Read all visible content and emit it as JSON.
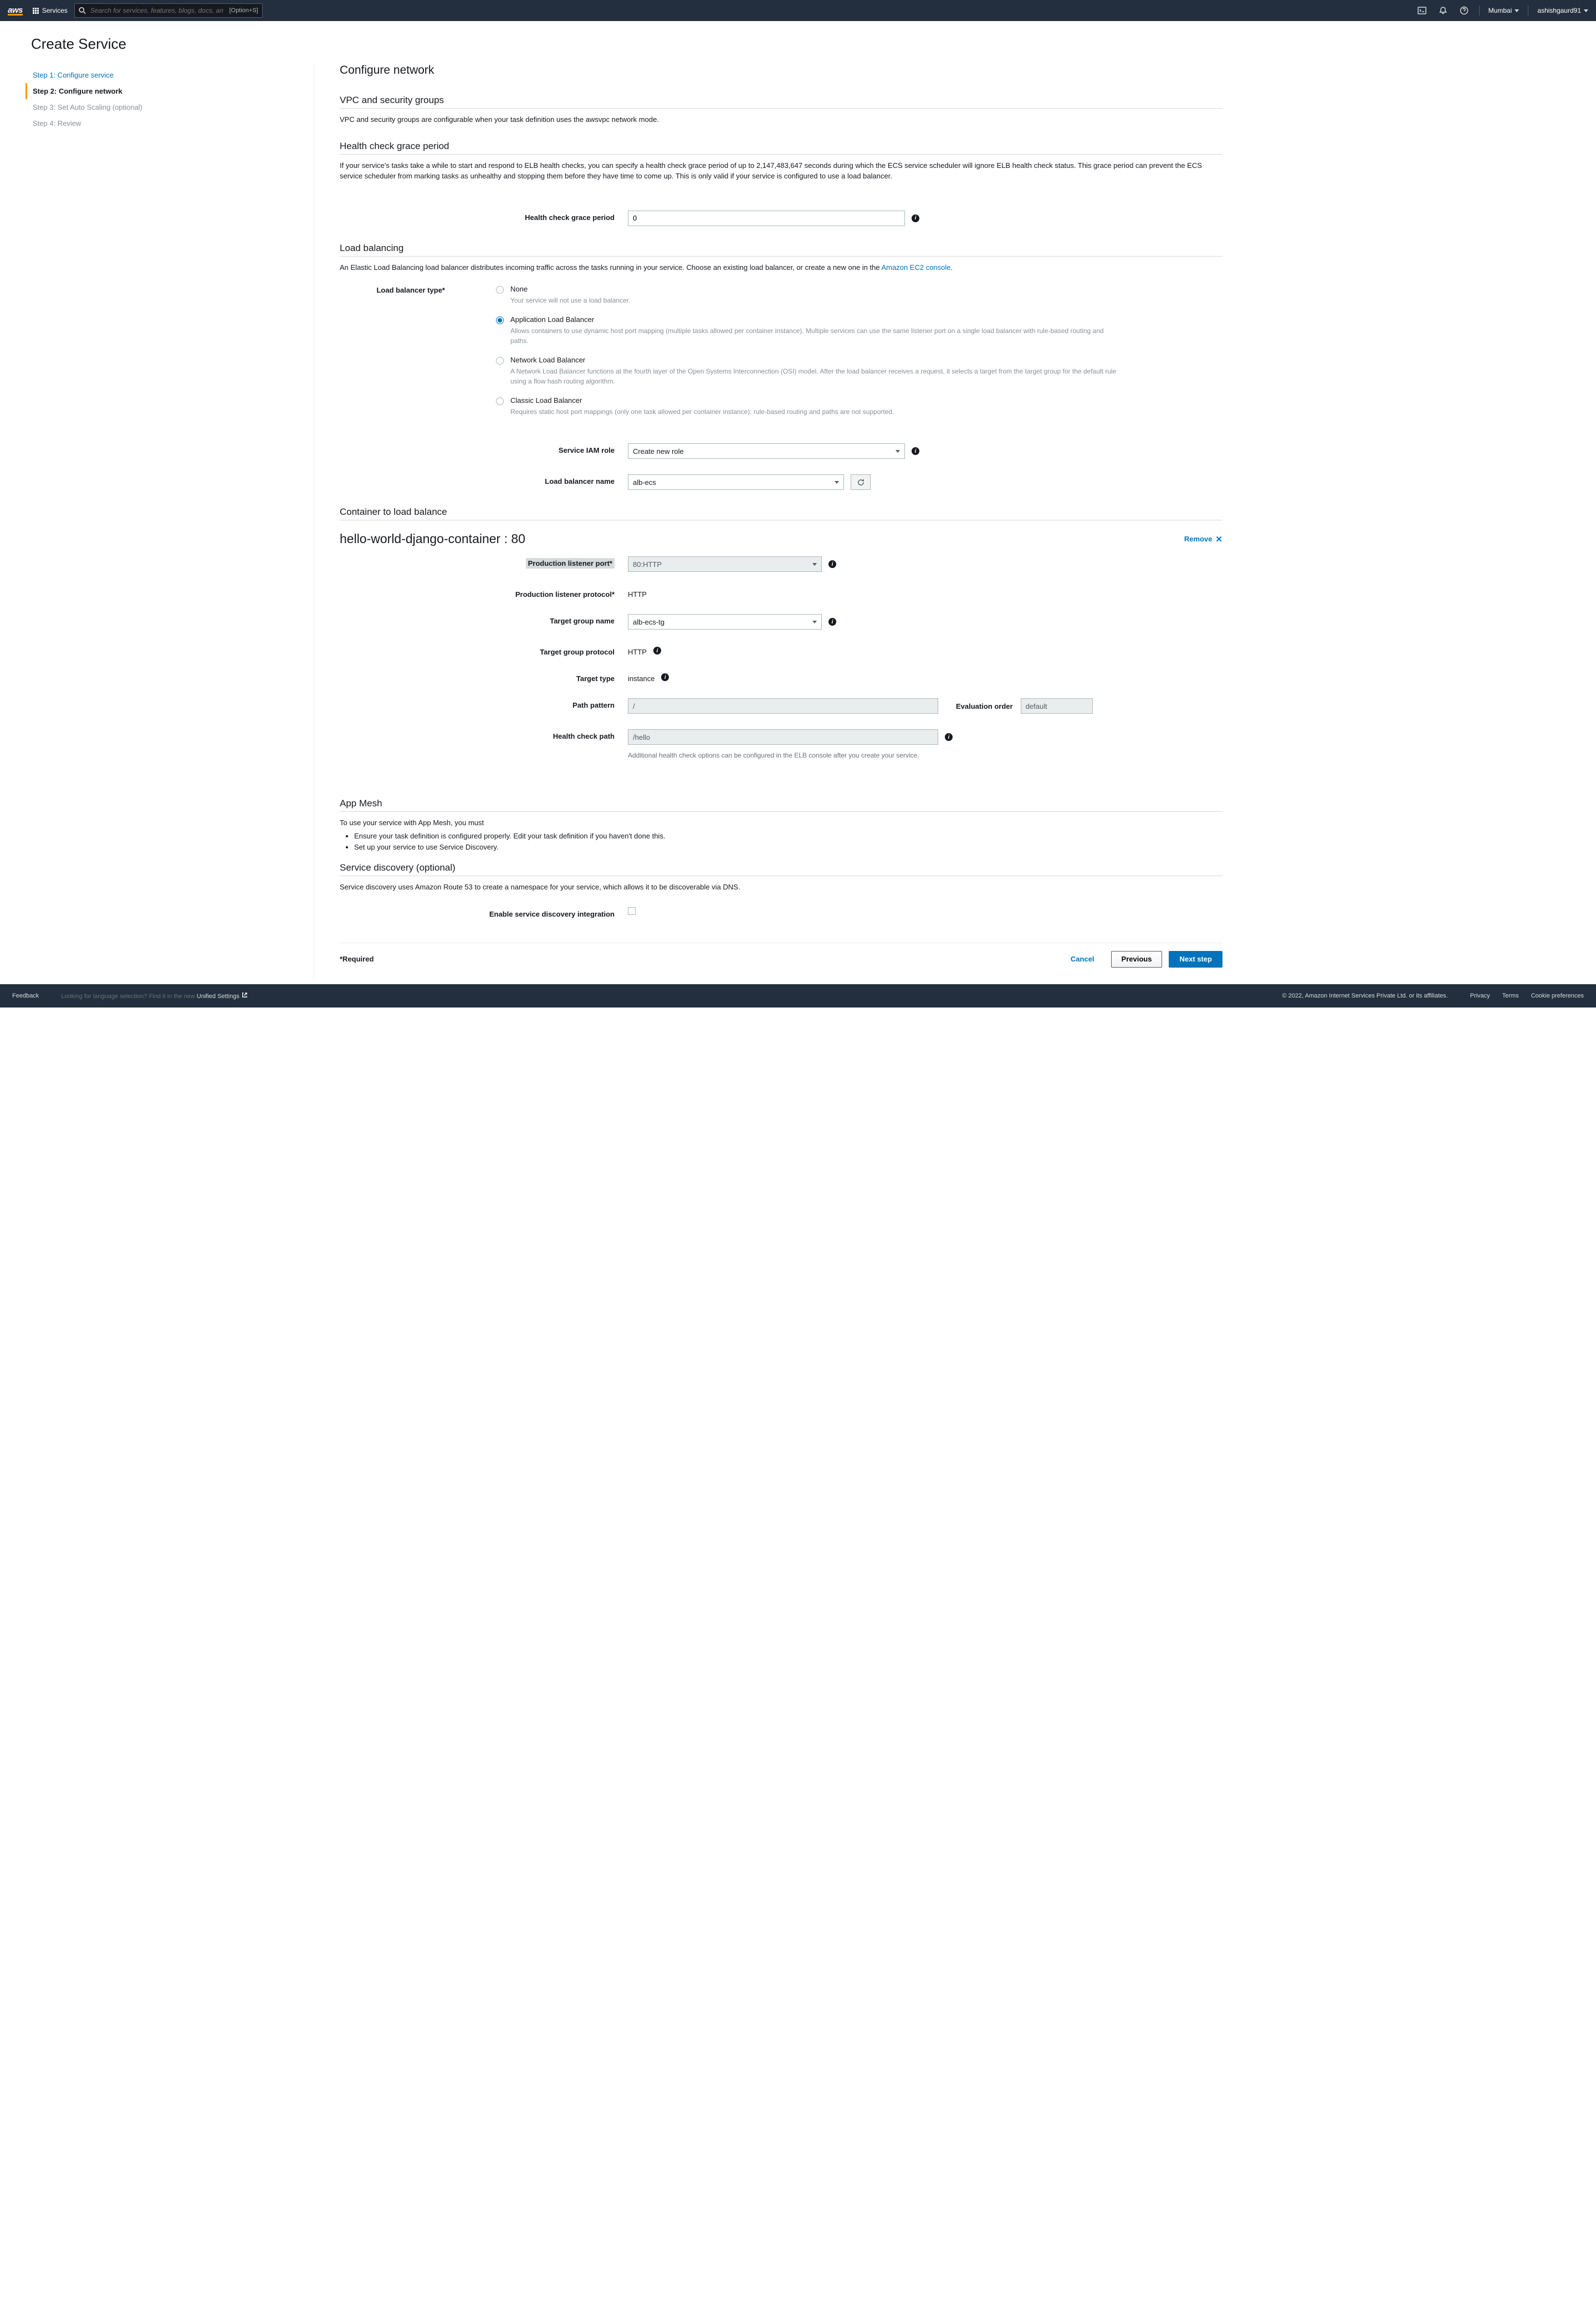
{
  "nav": {
    "logo": "aws",
    "services": "Services",
    "search_placeholder": "Search for services, features, blogs, docs, and more",
    "search_shortcut": "[Option+S]",
    "region": "Mumbai",
    "user": "ashishgaurd91"
  },
  "page": {
    "title": "Create Service"
  },
  "steps": [
    {
      "label": "Step 1: Configure service",
      "state": "link"
    },
    {
      "label": "Step 2: Configure network",
      "state": "active"
    },
    {
      "label": "Step 3: Set Auto Scaling (optional)",
      "state": "future"
    },
    {
      "label": "Step 4: Review",
      "state": "future"
    }
  ],
  "main_title": "Configure network",
  "vpc": {
    "title": "VPC and security groups",
    "desc": "VPC and security groups are configurable when your task definition uses the awsvpc network mode."
  },
  "hc": {
    "title": "Health check grace period",
    "desc": "If your service's tasks take a while to start and respond to ELB health checks, you can specify a health check grace period of up to 2,147,483,647 seconds during which the ECS service scheduler will ignore ELB health check status. This grace period can prevent the ECS service scheduler from marking tasks as unhealthy and stopping them before they have time to come up. This is only valid if your service is configured to use a load balancer.",
    "label": "Health check grace period",
    "value": "0"
  },
  "lb": {
    "title": "Load balancing",
    "desc_pre": "An Elastic Load Balancing load balancer distributes incoming traffic across the tasks running in your service. Choose an existing load balancer, or create a new one in the ",
    "desc_link": "Amazon EC2 console",
    "desc_post": ".",
    "type_label": "Load balancer type*",
    "options": [
      {
        "title": "None",
        "desc": "Your service will not use a load balancer.",
        "selected": false
      },
      {
        "title": "Application Load Balancer",
        "desc": "Allows containers to use dynamic host port mapping (multiple tasks allowed per container instance). Multiple services can use the same listener port on a single load balancer with rule-based routing and paths.",
        "selected": true
      },
      {
        "title": "Network Load Balancer",
        "desc": "A Network Load Balancer functions at the fourth layer of the Open Systems Interconnection (OSI) model. After the load balancer receives a request, it selects a target from the target group for the default rule using a flow hash routing algorithm.",
        "selected": false
      },
      {
        "title": "Classic Load Balancer",
        "desc": "Requires static host port mappings (only one task allowed per container instance); rule-based routing and paths are not supported.",
        "selected": false
      }
    ],
    "iam_label": "Service IAM role",
    "iam_value": "Create new role",
    "name_label": "Load balancer name",
    "name_value": "alb-ecs"
  },
  "container": {
    "section_title": "Container to load balance",
    "heading": "hello-world-django-container : 80",
    "remove": "Remove",
    "listener_port_label": "Production listener port*",
    "listener_port_value": "80:HTTP",
    "listener_proto_label": "Production listener protocol*",
    "listener_proto_value": "HTTP",
    "tg_name_label": "Target group name",
    "tg_name_value": "alb-ecs-tg",
    "tg_proto_label": "Target group protocol",
    "tg_proto_value": "HTTP",
    "target_type_label": "Target type",
    "target_type_value": "instance",
    "path_label": "Path pattern",
    "path_value": "/",
    "eval_label": "Evaluation order",
    "eval_value": "default",
    "hc_path_label": "Health check path",
    "hc_path_value": "/hello",
    "hc_help": "Additional health check options can be configured in the ELB console after you create your service."
  },
  "appmesh": {
    "title": "App Mesh",
    "desc": "To use your service with App Mesh, you must",
    "bullets": [
      "Ensure your task definition is configured properly. Edit your task definition if you haven't done this.",
      "Set up your service to use Service Discovery."
    ]
  },
  "sd": {
    "title": "Service discovery (optional)",
    "desc": "Service discovery uses Amazon Route 53 to create a namespace for your service, which allows it to be discoverable via DNS.",
    "checkbox_label": "Enable service discovery integration"
  },
  "footer_form": {
    "required": "*Required",
    "cancel": "Cancel",
    "previous": "Previous",
    "next": "Next step"
  },
  "footer": {
    "feedback": "Feedback",
    "lang_prompt": "Looking for language selection? Find it in the new ",
    "unified": "Unified Settings",
    "copyright": "© 2022, Amazon Internet Services Private Ltd. or its affiliates.",
    "privacy": "Privacy",
    "terms": "Terms",
    "cookie": "Cookie preferences"
  }
}
